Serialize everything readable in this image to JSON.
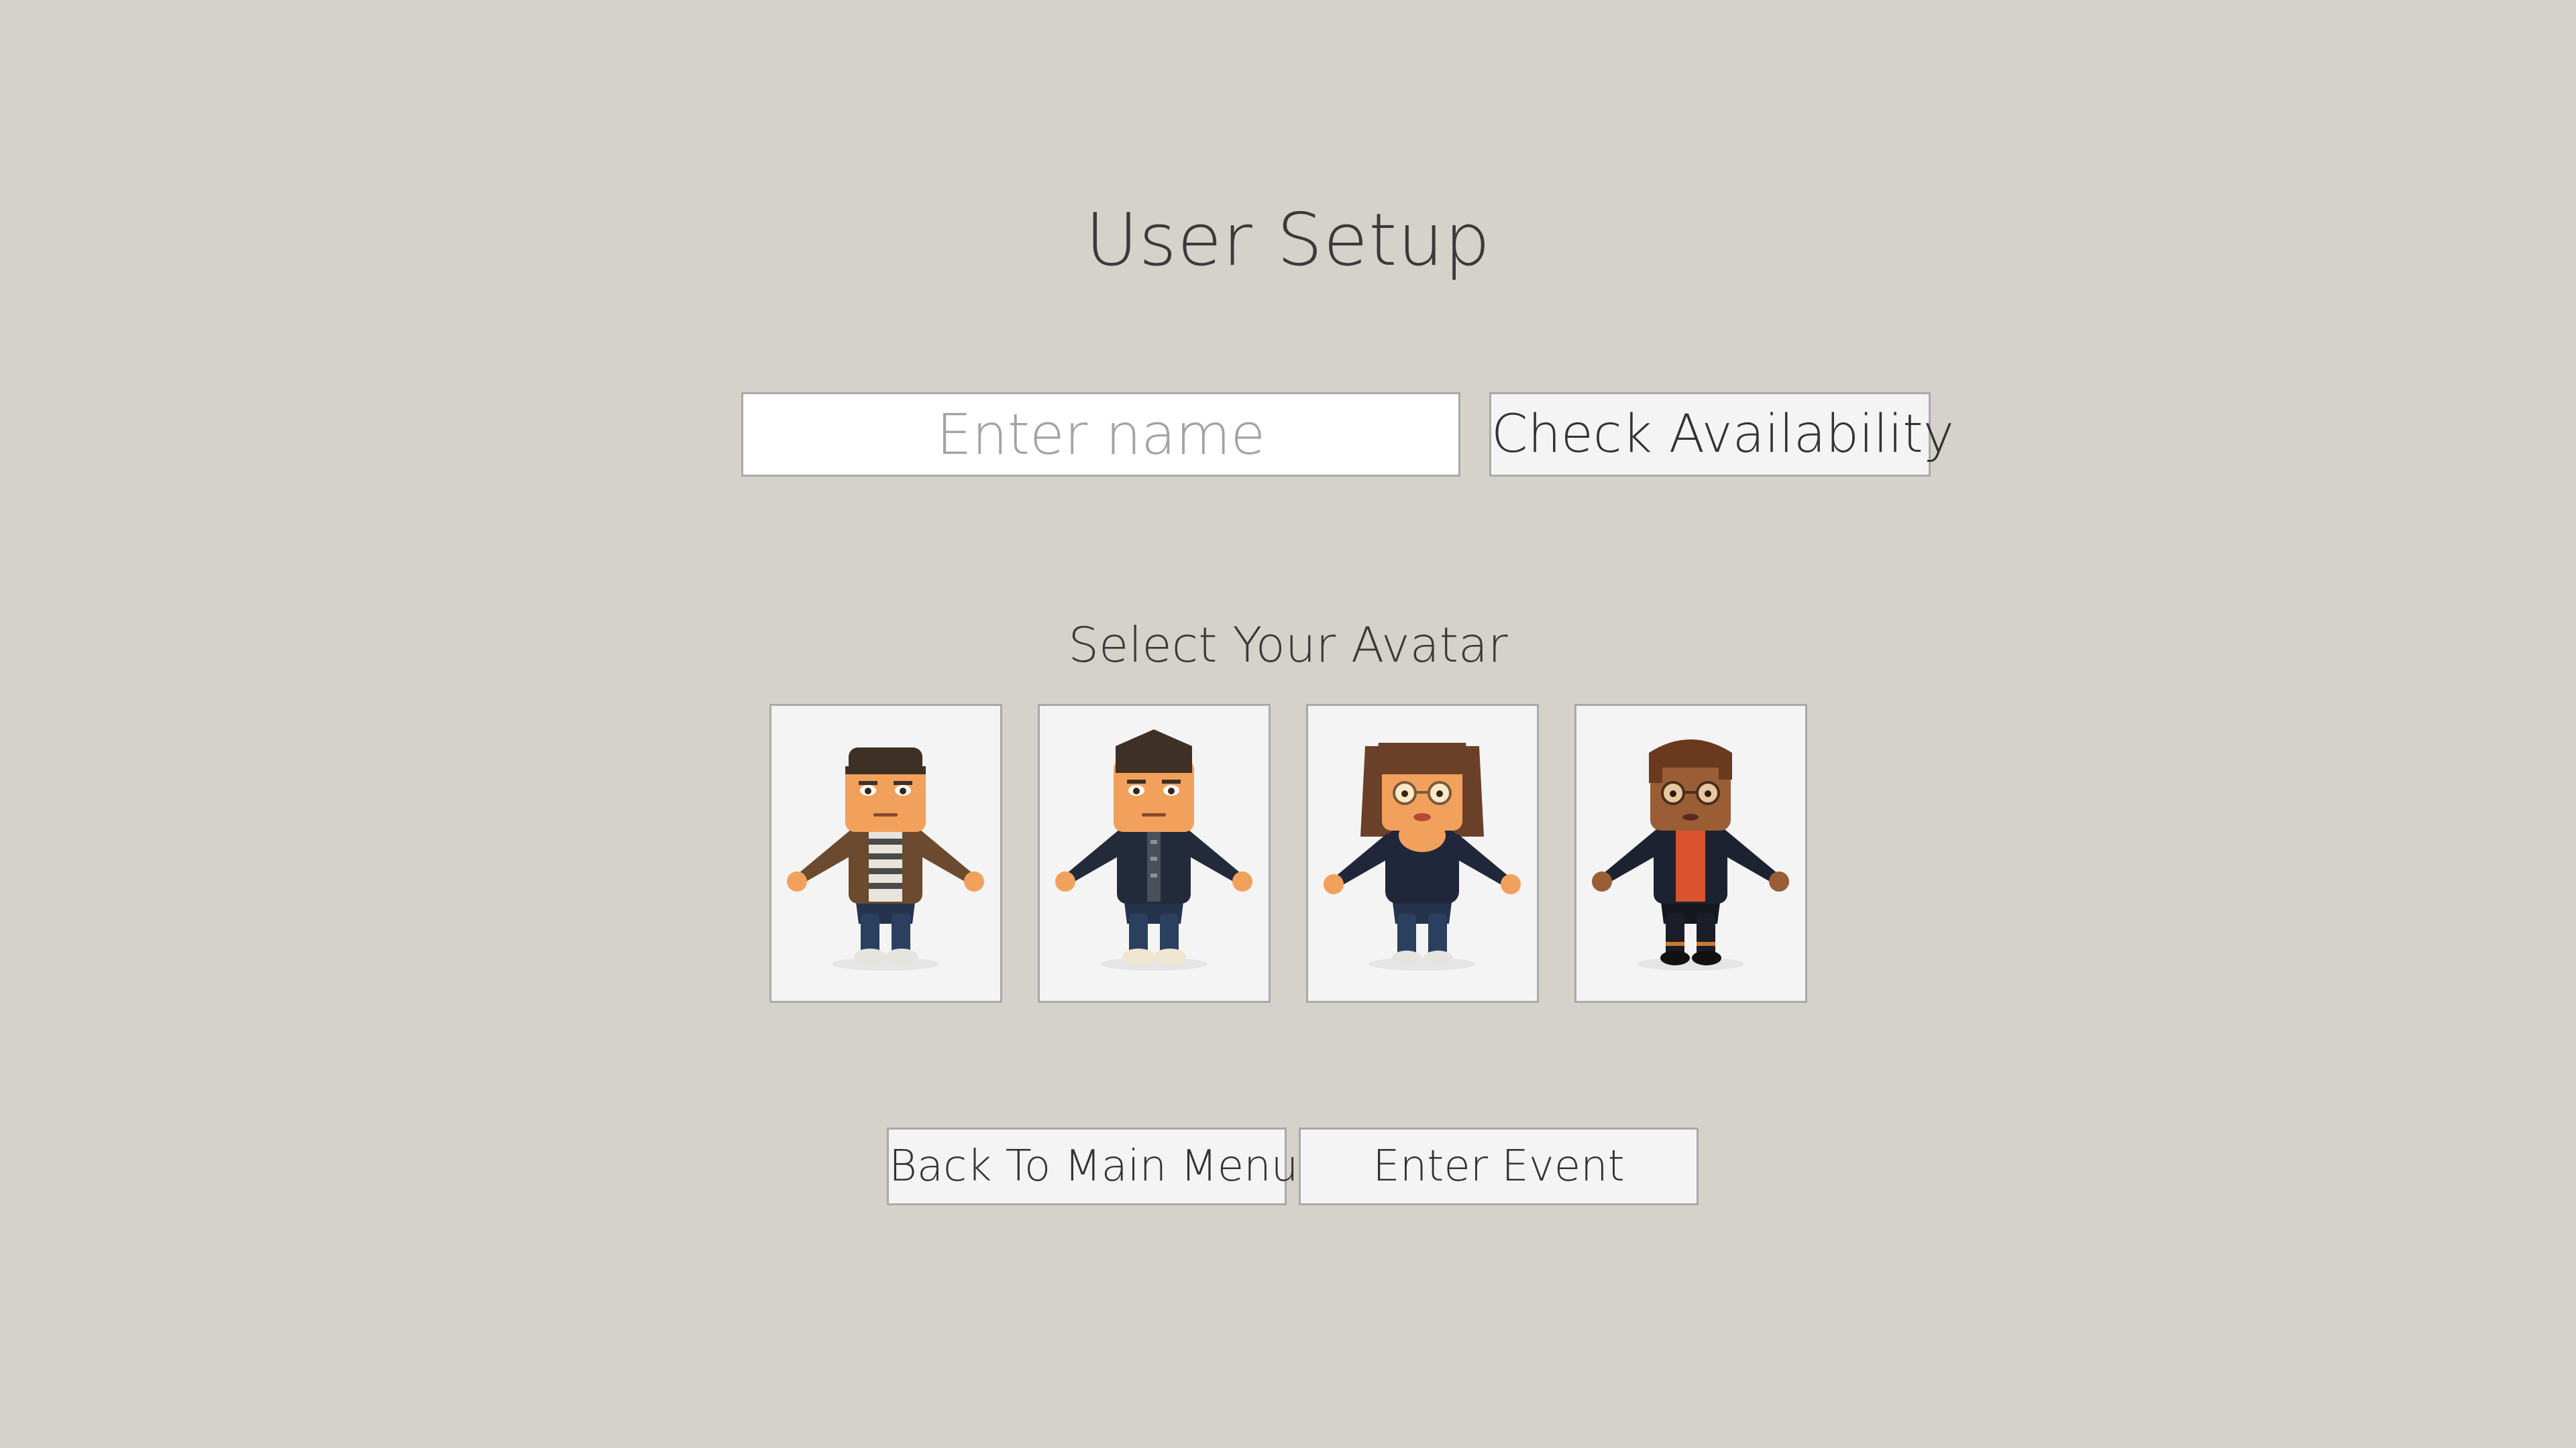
{
  "page": {
    "title": "User Setup",
    "background_color": "#d5d2cb"
  },
  "name_form": {
    "input_value": "",
    "input_placeholder": "Enter name",
    "check_button_label": "Check Availability"
  },
  "avatar_section": {
    "label": "Select Your Avatar",
    "avatars": [
      {
        "icon": "avatar-male-brown-jacket-icon",
        "outfit": "brown jacket, striped shirt, blue jeans"
      },
      {
        "icon": "avatar-male-dark-jacket-icon",
        "outfit": "dark jacket, blue jeans"
      },
      {
        "icon": "avatar-female-long-hair-icon",
        "outfit": "dark top, blue jeans, glasses"
      },
      {
        "icon": "avatar-female-red-top-icon",
        "outfit": "dark jacket, red top, glasses"
      }
    ]
  },
  "footer": {
    "back_button_label": "Back To Main Menu",
    "enter_button_label": "Enter Event"
  }
}
